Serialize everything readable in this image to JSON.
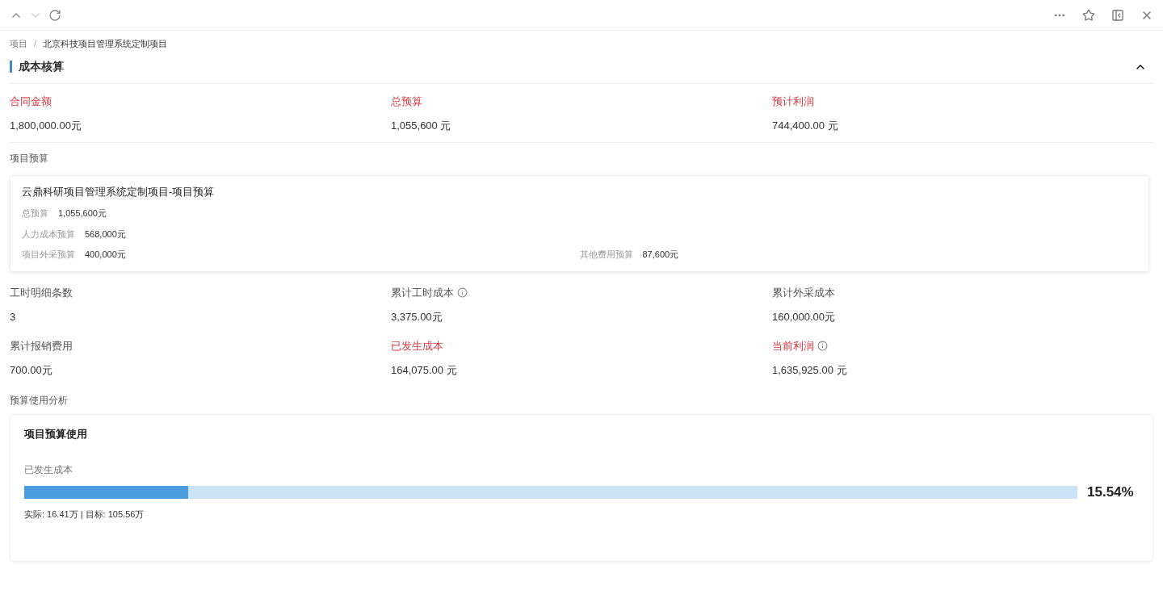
{
  "breadcrumb": [
    {
      "label": "项目"
    },
    {
      "label": "北京科技项目管理系统定制项目"
    }
  ],
  "breadcrumb_separator": "/",
  "section": {
    "title": "成本核算",
    "expanded": true
  },
  "summary": [
    {
      "label": "合同金额",
      "value": "1,800,000.00元",
      "highlight": true,
      "info": false
    },
    {
      "label": "总预算",
      "value": "1,055,600 元",
      "highlight": true,
      "info": false
    },
    {
      "label": "预计利润",
      "value": "744,400.00 元",
      "highlight": true,
      "info": false
    }
  ],
  "budget": {
    "heading": "项目预算",
    "card_title": "云鼎科研项目管理系统定制项目-项目预算",
    "rows": [
      [
        {
          "label": "总预算",
          "value": "1,055,600元"
        }
      ],
      [
        {
          "label": "人力成本预算",
          "value": "568,000元"
        }
      ],
      [
        {
          "label": "项目外采预算",
          "value": "400,000元"
        },
        {
          "label": "其他费用预算",
          "value": "87,600元"
        }
      ]
    ]
  },
  "stats": [
    {
      "label": "工时明细条数",
      "value": "3",
      "highlight": false,
      "info": false
    },
    {
      "label": "累计工时成本",
      "value": "3,375.00元",
      "highlight": false,
      "info": true
    },
    {
      "label": "累计外采成本",
      "value": "160,000.00元",
      "highlight": false,
      "info": false
    },
    {
      "label": "累计报销费用",
      "value": "700.00元",
      "highlight": false,
      "info": false
    },
    {
      "label": "已发生成本",
      "value": "164,075.00 元",
      "highlight": true,
      "info": false
    },
    {
      "label": "当前利润",
      "value": "1,635,925.00 元",
      "highlight": true,
      "info": true
    }
  ],
  "analysis": {
    "heading": "预算使用分析",
    "card_title": "项目预算使用",
    "bar_label": "已发生成本",
    "level": 0.1554,
    "percent": "15.54%",
    "caption": "实际: 16.41万 | 目标: 105.56万"
  }
}
